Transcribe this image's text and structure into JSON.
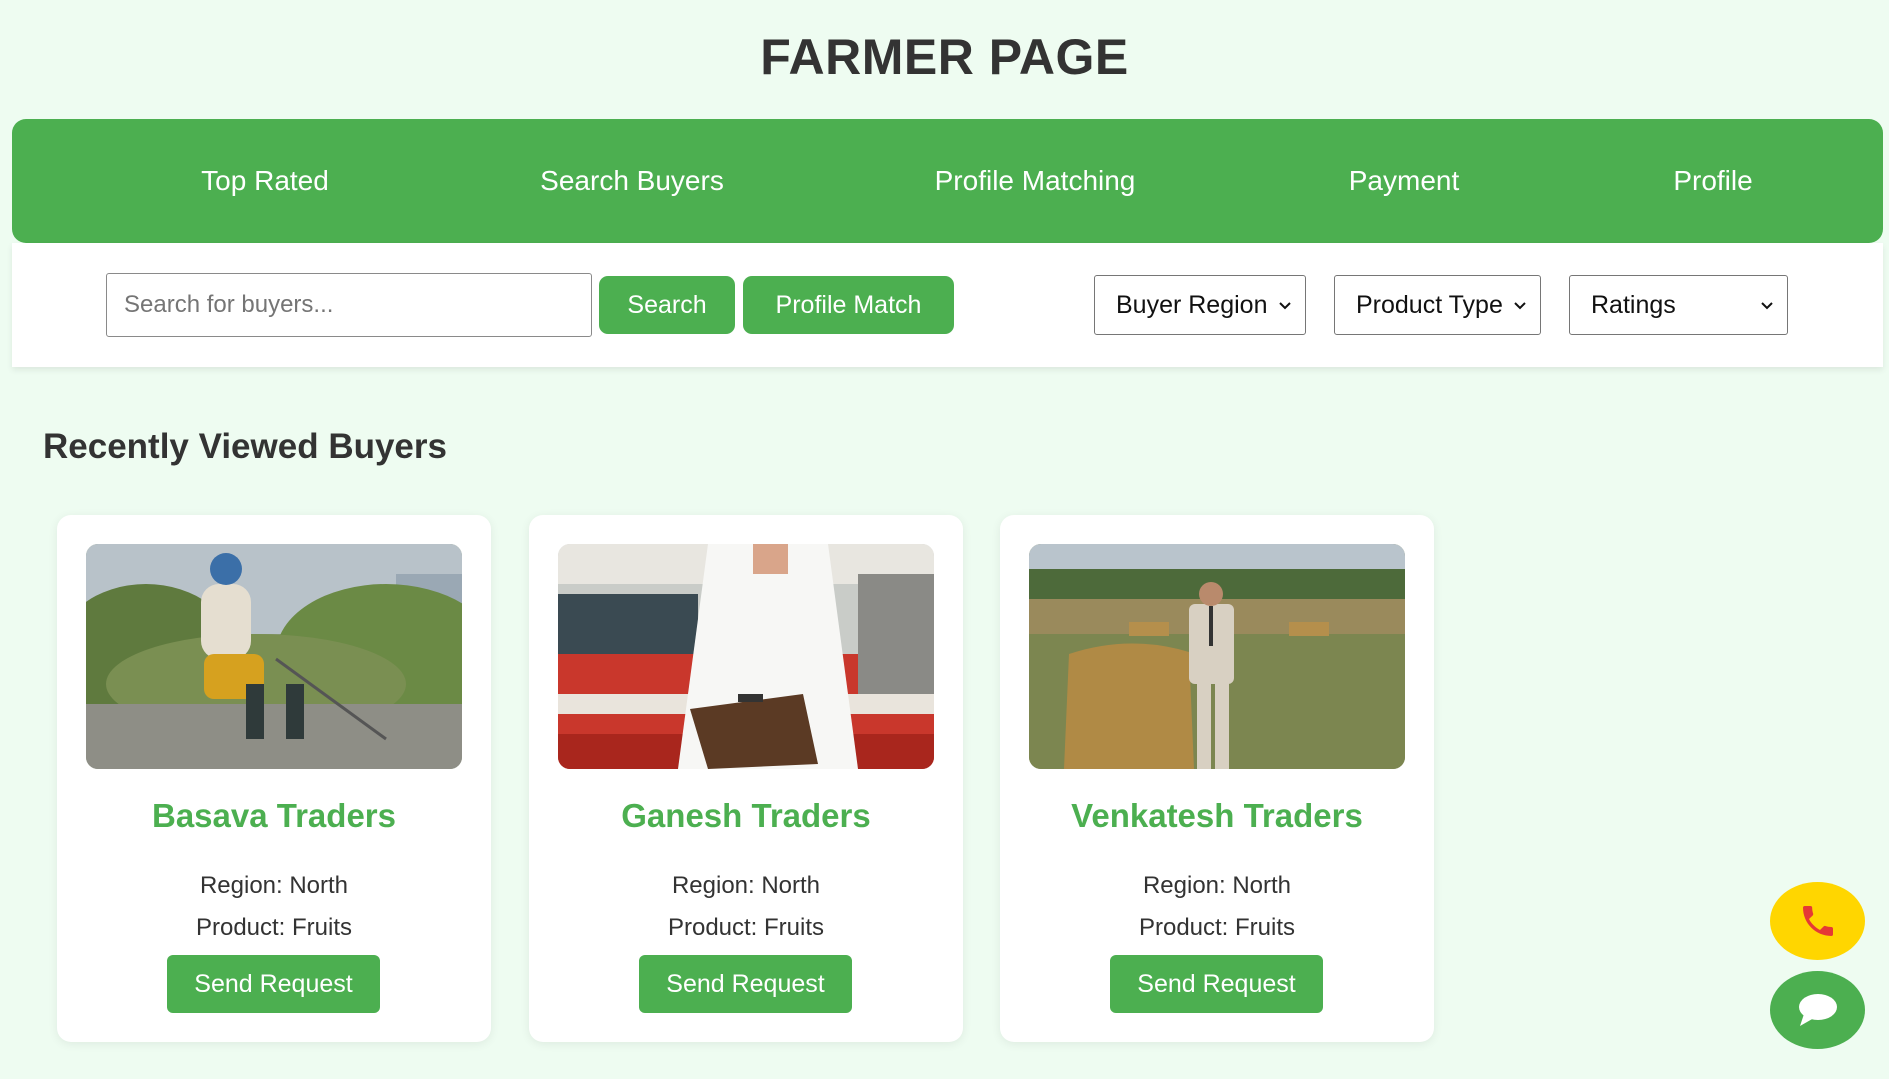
{
  "page_title": "FARMER PAGE",
  "nav": {
    "items": [
      {
        "label": "Top Rated"
      },
      {
        "label": "Search Buyers"
      },
      {
        "label": "Profile Matching"
      },
      {
        "label": "Payment"
      },
      {
        "label": "Profile"
      }
    ]
  },
  "toolbar": {
    "search_placeholder": "Search for buyers...",
    "search_value": "",
    "search_button": "Search",
    "profile_match_button": "Profile Match",
    "filters": [
      {
        "selected": "Buyer Region"
      },
      {
        "selected": "Product Type"
      },
      {
        "selected": "Ratings"
      }
    ]
  },
  "recent": {
    "title": "Recently Viewed Buyers",
    "buyers": [
      {
        "name": "Basava Traders",
        "region": "Region: North",
        "product": "Product: Fruits",
        "button": "Send Request",
        "image": "scarecrow-photo"
      },
      {
        "name": "Ganesh Traders",
        "region": "Region: North",
        "product": "Product: Fruits",
        "button": "Send Request",
        "image": "man-with-clipboard-tractor-photo"
      },
      {
        "name": "Venkatesh Traders",
        "region": "Region: North",
        "product": "Product: Fruits",
        "button": "Send Request",
        "image": "man-in-suit-hay-bale-photo"
      }
    ]
  },
  "floating": {
    "call_icon": "phone-icon",
    "chat_icon": "chat-bubble-icon"
  },
  "colors": {
    "accent": "#4caf50",
    "background": "#eefcf1",
    "call_button": "#ffd600",
    "phone_icon": "#e53935"
  }
}
